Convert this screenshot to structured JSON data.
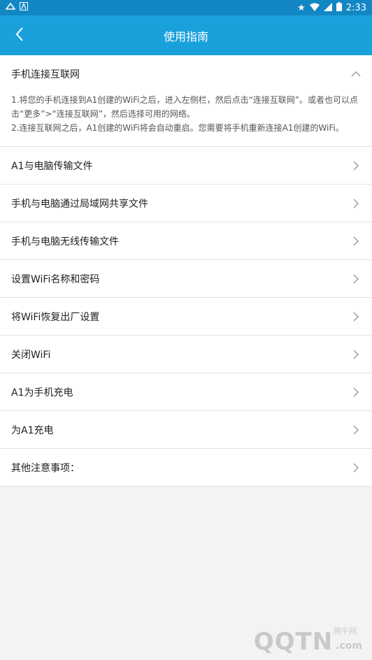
{
  "status_bar": {
    "time": "2:33",
    "left_icons": [
      "wifi-app-icon",
      "a-app-icon"
    ],
    "right_icons": [
      "star-icon",
      "wifi-signal-icon",
      "cell-signal-icon",
      "battery-icon"
    ]
  },
  "app_bar": {
    "title": "使用指南"
  },
  "expanded_section": {
    "title": "手机连接互联网",
    "lines": [
      "1.将您的手机连接到A1创建的WiFi之后，进入左侧栏，然后点击“连接互联网”。或者也可以点击“更多”>“连接互联网”，然后选择可用的网络。",
      "2.连接互联网之后，A1创建的WiFi将会自动重启。您需要将手机重新连接A1创建的WiFi。"
    ]
  },
  "items": [
    {
      "label": "A1与电脑传输文件"
    },
    {
      "label": "手机与电脑通过局域网共享文件"
    },
    {
      "label": "手机与电脑无线传输文件"
    },
    {
      "label": "设置WiFi名称和密码"
    },
    {
      "label": "将WiFi恢复出厂设置"
    },
    {
      "label": "关闭WiFi"
    },
    {
      "label": "A1为手机充电"
    },
    {
      "label": "为A1充电"
    },
    {
      "label": "其他注意事项："
    }
  ],
  "watermark": {
    "small": "腾牛网",
    "large": "QQTN",
    "suffix": ".com"
  },
  "colors": {
    "status_bar": "#1386c4",
    "app_bar": "#19a1dc"
  }
}
